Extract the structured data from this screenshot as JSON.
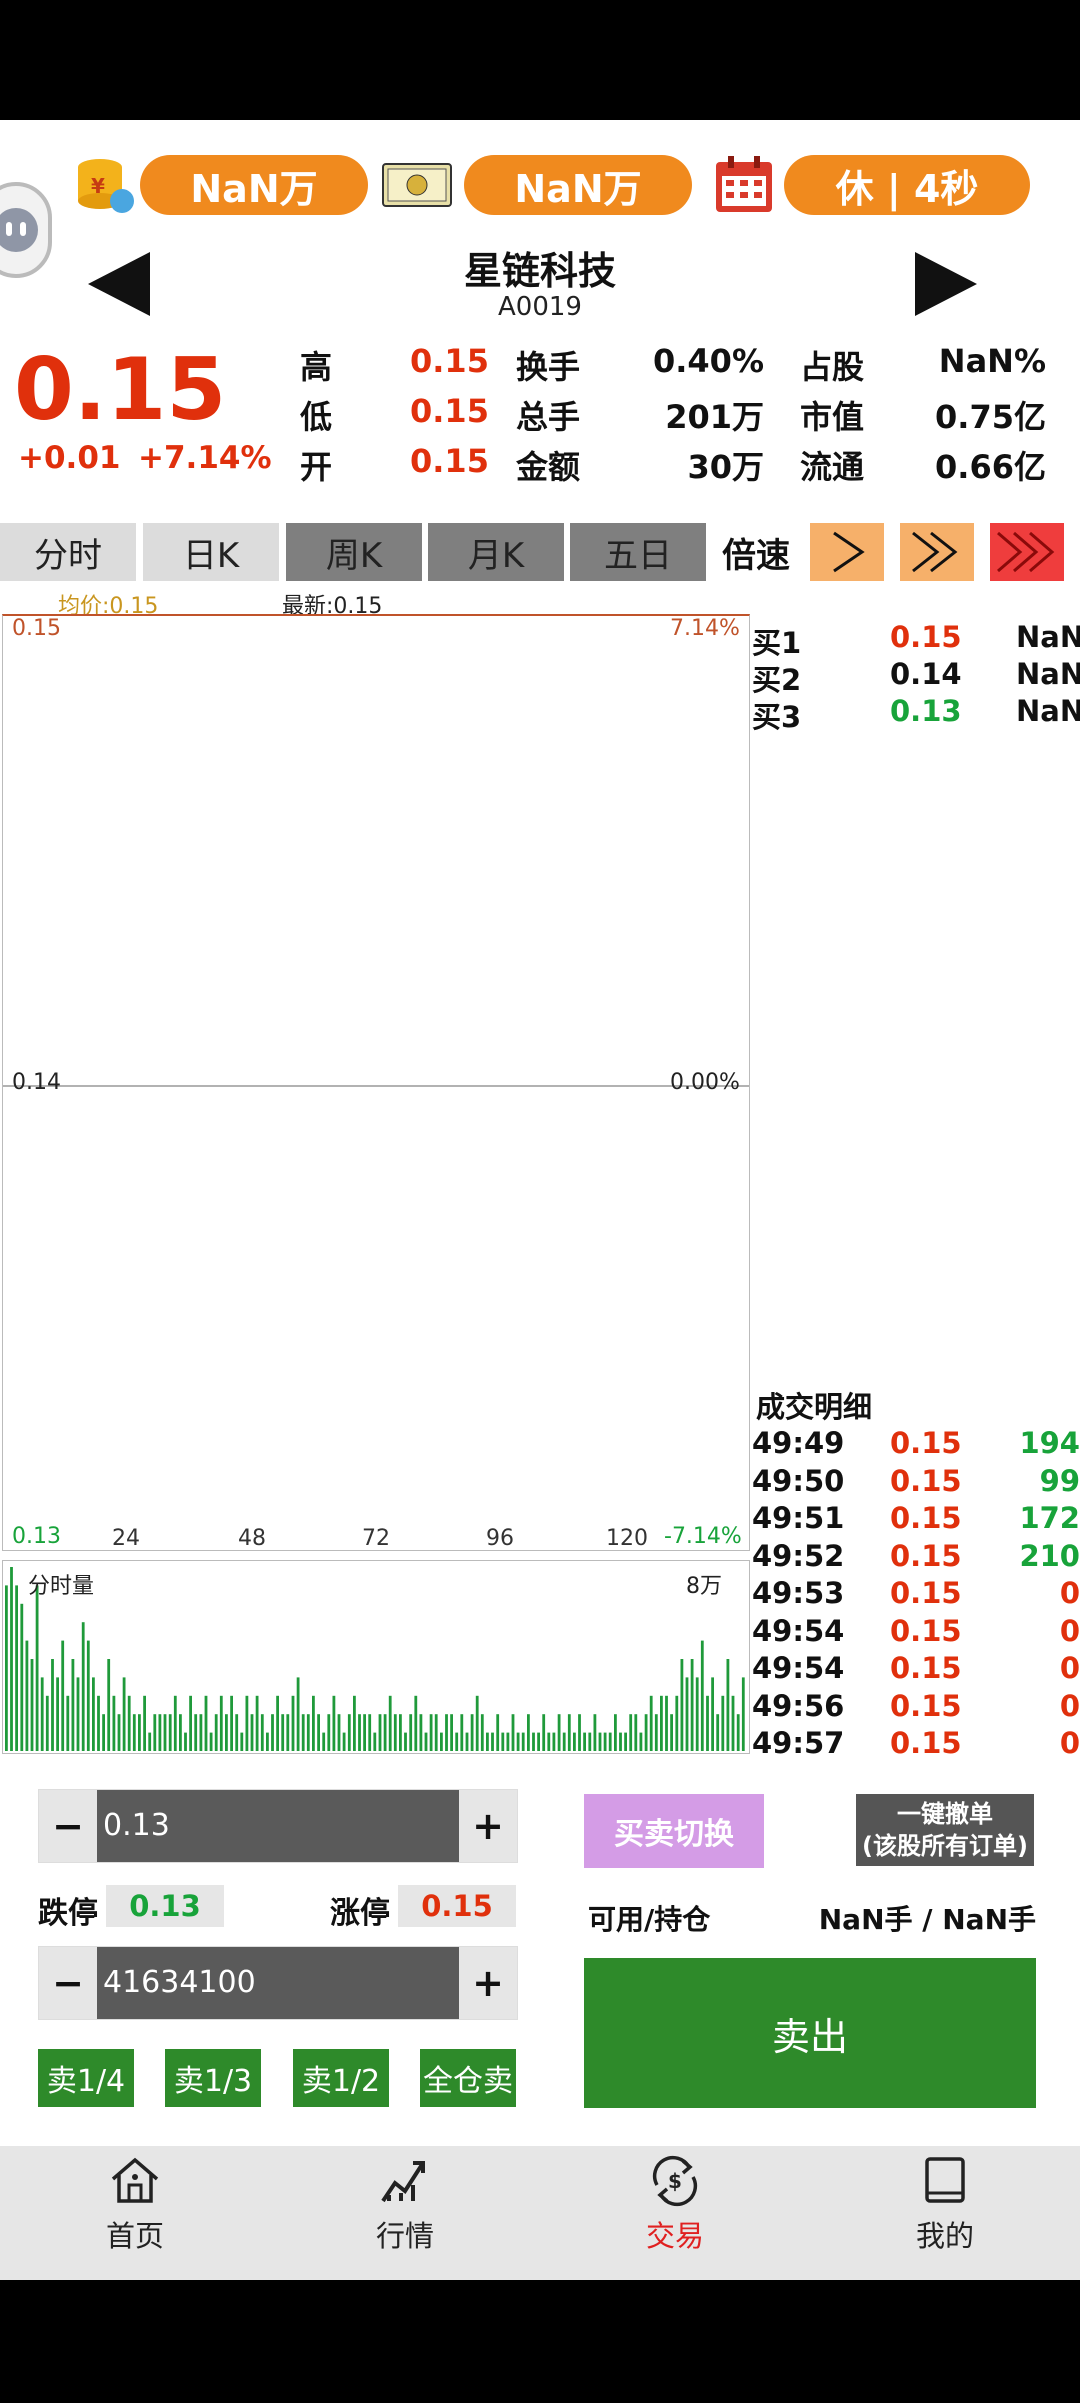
{
  "header": {
    "coin_value": "NaN万",
    "cash_value": "NaN万",
    "status_value": "休 | 4秒"
  },
  "stock": {
    "name": "星链科技",
    "code": "A0019",
    "price": "0.15",
    "change": "+0.01",
    "change_pct": "+7.14%"
  },
  "stats": [
    {
      "label": "高",
      "value": "0.15"
    },
    {
      "label": "换手",
      "value": "0.40%"
    },
    {
      "label": "占股",
      "value": "NaN%"
    },
    {
      "label": "低",
      "value": "0.15"
    },
    {
      "label": "总手",
      "value": "201万"
    },
    {
      "label": "市值",
      "value": "0.75亿"
    },
    {
      "label": "开",
      "value": "0.15"
    },
    {
      "label": "金额",
      "value": "30万"
    },
    {
      "label": "流通",
      "value": "0.66亿"
    }
  ],
  "tabs": [
    "分时",
    "日K",
    "周K",
    "月K",
    "五日"
  ],
  "speed_label": "倍速",
  "chart_header": {
    "avg": "均价:0.15",
    "latest": "最新:0.15"
  },
  "chart_data": {
    "type": "line",
    "y_labels": [
      "0.15",
      "0.14",
      "0.13"
    ],
    "y_right_labels": [
      "7.14%",
      "0.00%",
      "-7.14%"
    ],
    "x_ticks": [
      "24",
      "48",
      "72",
      "96",
      "120"
    ],
    "ylim": [
      0.13,
      0.15
    ],
    "volume_label": "分时量",
    "volume_max_label": "8万",
    "volume_values": [
      9,
      10,
      9,
      8,
      6,
      5,
      9,
      4,
      3,
      5,
      4,
      6,
      3,
      5,
      4,
      7,
      6,
      4,
      3,
      2,
      5,
      3,
      2,
      4,
      3,
      2,
      2,
      3,
      1,
      2,
      2,
      2,
      2,
      3,
      2,
      1,
      3,
      2,
      2,
      3,
      1,
      2,
      3,
      2,
      3,
      2,
      1,
      3,
      2,
      3,
      2,
      1,
      2,
      3,
      2,
      2,
      3,
      4,
      2,
      2,
      3,
      2,
      1,
      2,
      3,
      2,
      1,
      2,
      3,
      2,
      2,
      2,
      1,
      2,
      2,
      3,
      2,
      2,
      1,
      2,
      3,
      2,
      1,
      2,
      2,
      1,
      2,
      2,
      1,
      2,
      1,
      2,
      3,
      2,
      1,
      1,
      2,
      1,
      1,
      2,
      1,
      1,
      2,
      1,
      1,
      2,
      1,
      1,
      2,
      1,
      2,
      1,
      2,
      1,
      1,
      2,
      1,
      1,
      1,
      2,
      1,
      1,
      2,
      2,
      1,
      2,
      3,
      2,
      3,
      3,
      2,
      3,
      5,
      4,
      5,
      4,
      6,
      3,
      4,
      2,
      3,
      5,
      3,
      2,
      4
    ]
  },
  "orderbook": [
    {
      "label": "买1",
      "price": "0.15",
      "vol": "NaN",
      "tone": "red"
    },
    {
      "label": "买2",
      "price": "0.14",
      "vol": "NaN",
      "tone": "blk"
    },
    {
      "label": "买3",
      "price": "0.13",
      "vol": "NaN",
      "tone": "green"
    }
  ],
  "trades_title": "成交明细",
  "trades": [
    {
      "time": "49:49",
      "price": "0.15",
      "vol": "194",
      "tone": "green"
    },
    {
      "time": "49:50",
      "price": "0.15",
      "vol": "99",
      "tone": "green"
    },
    {
      "time": "49:51",
      "price": "0.15",
      "vol": "172",
      "tone": "green"
    },
    {
      "time": "49:52",
      "price": "0.15",
      "vol": "210",
      "tone": "green"
    },
    {
      "time": "49:53",
      "price": "0.15",
      "vol": "0",
      "tone": "red"
    },
    {
      "time": "49:54",
      "price": "0.15",
      "vol": "0",
      "tone": "red"
    },
    {
      "time": "49:54",
      "price": "0.15",
      "vol": "0",
      "tone": "red"
    },
    {
      "time": "49:56",
      "price": "0.15",
      "vol": "0",
      "tone": "red"
    },
    {
      "time": "49:57",
      "price": "0.15",
      "vol": "0",
      "tone": "red"
    }
  ],
  "trade_form": {
    "price_value": "0.13",
    "limit_down_label": "跌停",
    "limit_down": "0.13",
    "limit_up_label": "涨停",
    "limit_up": "0.15",
    "qty_value": "41634100",
    "quick": [
      "卖1/4",
      "卖1/3",
      "卖1/2",
      "全仓卖"
    ],
    "switch_label": "买卖切换",
    "cancel_line1": "一键撤单",
    "cancel_line2": "(该股所有订单)",
    "avail_label": "可用/持仓",
    "avail_value": "NaN手 / NaN手",
    "sell_label": "卖出"
  },
  "nav": [
    {
      "label": "首页",
      "active": false
    },
    {
      "label": "行情",
      "active": false
    },
    {
      "label": "交易",
      "active": true
    },
    {
      "label": "我的",
      "active": false
    }
  ]
}
